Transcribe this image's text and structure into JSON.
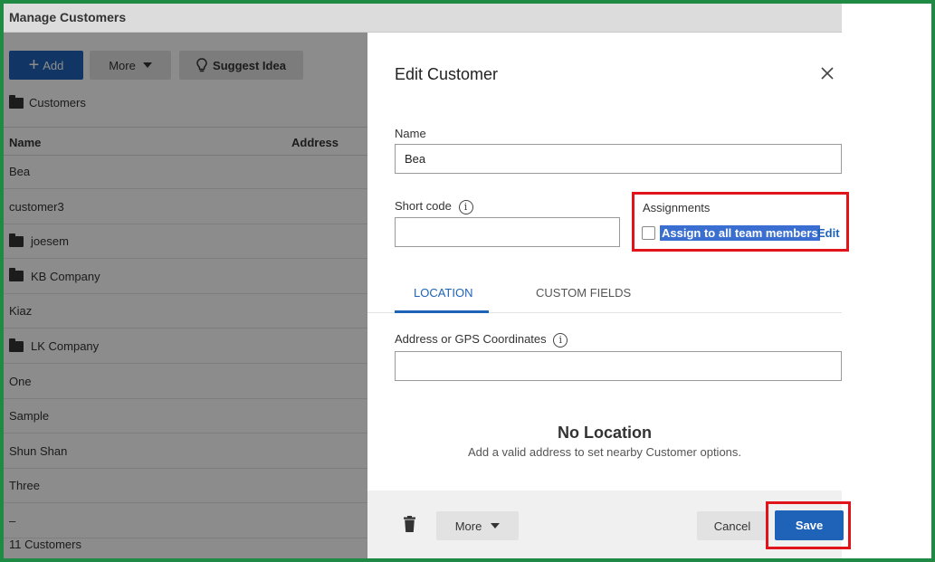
{
  "app": {
    "title": "Manage Customers",
    "toolbar": {
      "add_label": "Add",
      "more_label": "More",
      "suggest_label": "Suggest Idea"
    },
    "breadcrumb": "Customers",
    "columns": {
      "name": "Name",
      "address": "Address"
    },
    "rows": [
      {
        "label": "Bea",
        "folder": false
      },
      {
        "label": "customer3",
        "folder": false
      },
      {
        "label": "joesem",
        "folder": true
      },
      {
        "label": "KB Company",
        "folder": true
      },
      {
        "label": "Kiaz",
        "folder": false
      },
      {
        "label": "LK Company",
        "folder": true
      },
      {
        "label": "One",
        "folder": false
      },
      {
        "label": "Sample",
        "folder": false
      },
      {
        "label": "Shun Shan",
        "folder": false
      },
      {
        "label": "Three",
        "folder": false
      },
      {
        "label": "–",
        "folder": false
      }
    ],
    "footer_count": "11 Customers"
  },
  "dialog": {
    "title": "Edit Customer",
    "name_label": "Name",
    "name_value": "Bea",
    "short_code_label": "Short code",
    "short_code_value": "",
    "assignments": {
      "label": "Assignments",
      "checkbox_label": "Assign to all team members",
      "checked": false,
      "edit_label": "Edit"
    },
    "tabs": [
      {
        "label": "LOCATION",
        "active": true
      },
      {
        "label": "CUSTOM FIELDS",
        "active": false
      }
    ],
    "address_label": "Address or GPS Coordinates",
    "address_value": "",
    "no_location_title": "No Location",
    "no_location_subtitle": "Add a valid address to set nearby Customer options.",
    "footer": {
      "more_label": "More",
      "cancel_label": "Cancel",
      "save_label": "Save"
    }
  },
  "colors": {
    "frame_border": "#1e8a44",
    "primary": "#1f63b8",
    "highlight_border": "#e0141a",
    "selection": "#3a6fd1"
  }
}
